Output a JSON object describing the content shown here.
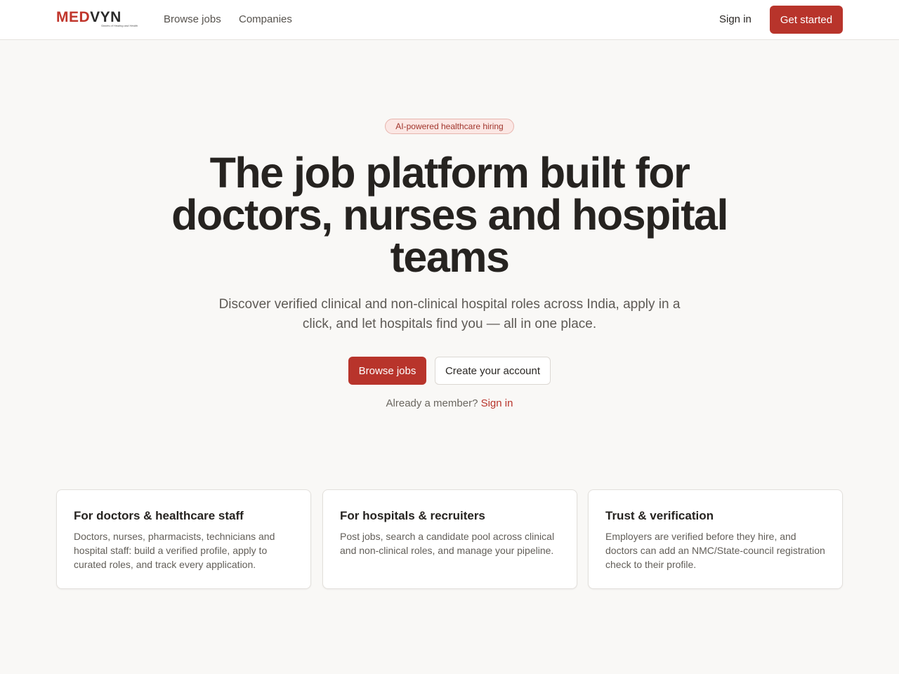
{
  "header": {
    "logo": {
      "brand_red": "MED",
      "brand_dark": "VYN",
      "tagline": "Stories of Healing and Health"
    },
    "nav": [
      {
        "label": "Browse jobs"
      },
      {
        "label": "Companies"
      }
    ],
    "sign_in": "Sign in",
    "get_started": "Get started"
  },
  "hero": {
    "badge": "AI-powered healthcare hiring",
    "title": "The job platform built for doctors, nurses and hospital teams",
    "subtitle": "Discover verified clinical and non-clinical hospital roles across India, apply in a click, and let hospitals find you — all in one place.",
    "primary_cta": "Browse jobs",
    "secondary_cta": "Create your account",
    "member_prompt": "Already a member?",
    "member_link": "Sign in"
  },
  "cards": [
    {
      "title": "For doctors & healthcare staff",
      "body": "Doctors, nurses, pharmacists, technicians and hospital staff: build a verified profile, apply to curated roles, and track every application."
    },
    {
      "title": "For hospitals & recruiters",
      "body": "Post jobs, search a candidate pool across clinical and non-clinical roles, and manage your pipeline."
    },
    {
      "title": "Trust & verification",
      "body": "Employers are verified before they hire, and doctors can add an NMC/State-council registration check to their profile."
    }
  ],
  "colors": {
    "accent": "#b8342b",
    "background": "#f9f8f6",
    "badge_bg": "#fbe7e4"
  }
}
